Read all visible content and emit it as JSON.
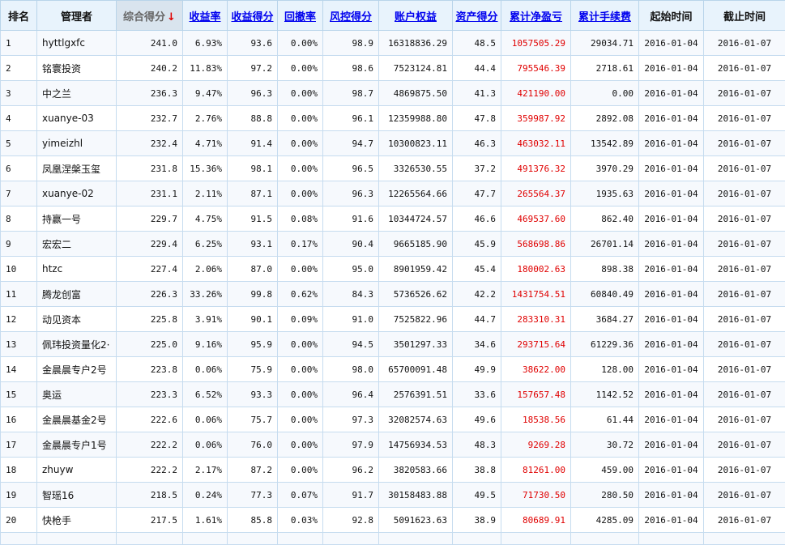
{
  "table": {
    "headers": {
      "rank": "排名",
      "manager": "管理者",
      "composite_score": "综合得分",
      "sort_arrow": "↓",
      "return_rate": "收益率",
      "return_score": "收益得分",
      "drawdown": "回撤率",
      "risk_score": "风控得分",
      "account_equity": "账户权益",
      "asset_score": "资产得分",
      "cum_net_profit": "累计净盈亏",
      "cum_fees": "累计手续费",
      "start_time": "起始时间",
      "end_time": "截止时间"
    },
    "accent_red": "#e00000",
    "link_blue": "#0000ee",
    "rows": [
      {
        "rank": "1",
        "manager": "hyttlgxfc",
        "composite": "241.0",
        "return_rate": "6.93%",
        "return_score": "93.6",
        "drawdown": "0.00%",
        "risk_score": "98.9",
        "equity": "16318836.29",
        "asset_score": "48.5",
        "net_profit": "1057505.29",
        "fees": "29034.71",
        "start": "2016-01-04",
        "end": "2016-01-07"
      },
      {
        "rank": "2",
        "manager": "铭寰投资",
        "composite": "240.2",
        "return_rate": "11.83%",
        "return_score": "97.2",
        "drawdown": "0.00%",
        "risk_score": "98.6",
        "equity": "7523124.81",
        "asset_score": "44.4",
        "net_profit": "795546.39",
        "fees": "2718.61",
        "start": "2016-01-04",
        "end": "2016-01-07"
      },
      {
        "rank": "3",
        "manager": "中之兰",
        "composite": "236.3",
        "return_rate": "9.47%",
        "return_score": "96.3",
        "drawdown": "0.00%",
        "risk_score": "98.7",
        "equity": "4869875.50",
        "asset_score": "41.3",
        "net_profit": "421190.00",
        "fees": "0.00",
        "start": "2016-01-04",
        "end": "2016-01-07"
      },
      {
        "rank": "4",
        "manager": "xuanye-03",
        "composite": "232.7",
        "return_rate": "2.76%",
        "return_score": "88.8",
        "drawdown": "0.00%",
        "risk_score": "96.1",
        "equity": "12359988.80",
        "asset_score": "47.8",
        "net_profit": "359987.92",
        "fees": "2892.08",
        "start": "2016-01-04",
        "end": "2016-01-07"
      },
      {
        "rank": "5",
        "manager": "yimeizhl",
        "composite": "232.4",
        "return_rate": "4.71%",
        "return_score": "91.4",
        "drawdown": "0.00%",
        "risk_score": "94.7",
        "equity": "10300823.11",
        "asset_score": "46.3",
        "net_profit": "463032.11",
        "fees": "13542.89",
        "start": "2016-01-04",
        "end": "2016-01-07"
      },
      {
        "rank": "6",
        "manager": "凤凰涅槃玉玺",
        "composite": "231.8",
        "return_rate": "15.36%",
        "return_score": "98.1",
        "drawdown": "0.00%",
        "risk_score": "96.5",
        "equity": "3326530.55",
        "asset_score": "37.2",
        "net_profit": "491376.32",
        "fees": "3970.29",
        "start": "2016-01-04",
        "end": "2016-01-07"
      },
      {
        "rank": "7",
        "manager": "xuanye-02",
        "composite": "231.1",
        "return_rate": "2.11%",
        "return_score": "87.1",
        "drawdown": "0.00%",
        "risk_score": "96.3",
        "equity": "12265564.66",
        "asset_score": "47.7",
        "net_profit": "265564.37",
        "fees": "1935.63",
        "start": "2016-01-04",
        "end": "2016-01-07"
      },
      {
        "rank": "8",
        "manager": "持赢一号",
        "composite": "229.7",
        "return_rate": "4.75%",
        "return_score": "91.5",
        "drawdown": "0.08%",
        "risk_score": "91.6",
        "equity": "10344724.57",
        "asset_score": "46.6",
        "net_profit": "469537.60",
        "fees": "862.40",
        "start": "2016-01-04",
        "end": "2016-01-07"
      },
      {
        "rank": "9",
        "manager": "宏宏二",
        "composite": "229.4",
        "return_rate": "6.25%",
        "return_score": "93.1",
        "drawdown": "0.17%",
        "risk_score": "90.4",
        "equity": "9665185.90",
        "asset_score": "45.9",
        "net_profit": "568698.86",
        "fees": "26701.14",
        "start": "2016-01-04",
        "end": "2016-01-07"
      },
      {
        "rank": "10",
        "manager": "htzc",
        "composite": "227.4",
        "return_rate": "2.06%",
        "return_score": "87.0",
        "drawdown": "0.00%",
        "risk_score": "95.0",
        "equity": "8901959.42",
        "asset_score": "45.4",
        "net_profit": "180002.63",
        "fees": "898.38",
        "start": "2016-01-04",
        "end": "2016-01-07"
      },
      {
        "rank": "11",
        "manager": "腾龙创富",
        "composite": "226.3",
        "return_rate": "33.26%",
        "return_score": "99.8",
        "drawdown": "0.62%",
        "risk_score": "84.3",
        "equity": "5736526.62",
        "asset_score": "42.2",
        "net_profit": "1431754.51",
        "fees": "60840.49",
        "start": "2016-01-04",
        "end": "2016-01-07"
      },
      {
        "rank": "12",
        "manager": "动见资本",
        "composite": "225.8",
        "return_rate": "3.91%",
        "return_score": "90.1",
        "drawdown": "0.09%",
        "risk_score": "91.0",
        "equity": "7525822.96",
        "asset_score": "44.7",
        "net_profit": "283310.31",
        "fees": "3684.27",
        "start": "2016-01-04",
        "end": "2016-01-07"
      },
      {
        "rank": "13",
        "manager": "佩玮投资量化2·",
        "composite": "225.0",
        "return_rate": "9.16%",
        "return_score": "95.9",
        "drawdown": "0.00%",
        "risk_score": "94.5",
        "equity": "3501297.33",
        "asset_score": "34.6",
        "net_profit": "293715.64",
        "fees": "61229.36",
        "start": "2016-01-04",
        "end": "2016-01-07"
      },
      {
        "rank": "14",
        "manager": "金晨晨专户2号",
        "composite": "223.8",
        "return_rate": "0.06%",
        "return_score": "75.9",
        "drawdown": "0.00%",
        "risk_score": "98.0",
        "equity": "65700091.48",
        "asset_score": "49.9",
        "net_profit": "38622.00",
        "fees": "128.00",
        "start": "2016-01-04",
        "end": "2016-01-07"
      },
      {
        "rank": "15",
        "manager": "奥运",
        "composite": "223.3",
        "return_rate": "6.52%",
        "return_score": "93.3",
        "drawdown": "0.00%",
        "risk_score": "96.4",
        "equity": "2576391.51",
        "asset_score": "33.6",
        "net_profit": "157657.48",
        "fees": "1142.52",
        "start": "2016-01-04",
        "end": "2016-01-07"
      },
      {
        "rank": "16",
        "manager": "金晨晨基金2号",
        "composite": "222.6",
        "return_rate": "0.06%",
        "return_score": "75.7",
        "drawdown": "0.00%",
        "risk_score": "97.3",
        "equity": "32082574.63",
        "asset_score": "49.6",
        "net_profit": "18538.56",
        "fees": "61.44",
        "start": "2016-01-04",
        "end": "2016-01-07"
      },
      {
        "rank": "17",
        "manager": "金晨晨专户1号",
        "composite": "222.2",
        "return_rate": "0.06%",
        "return_score": "76.0",
        "drawdown": "0.00%",
        "risk_score": "97.9",
        "equity": "14756934.53",
        "asset_score": "48.3",
        "net_profit": "9269.28",
        "fees": "30.72",
        "start": "2016-01-04",
        "end": "2016-01-07"
      },
      {
        "rank": "18",
        "manager": "zhuyw",
        "composite": "222.2",
        "return_rate": "2.17%",
        "return_score": "87.2",
        "drawdown": "0.00%",
        "risk_score": "96.2",
        "equity": "3820583.66",
        "asset_score": "38.8",
        "net_profit": "81261.00",
        "fees": "459.00",
        "start": "2016-01-04",
        "end": "2016-01-07"
      },
      {
        "rank": "19",
        "manager": "智瑶16",
        "composite": "218.5",
        "return_rate": "0.24%",
        "return_score": "77.3",
        "drawdown": "0.07%",
        "risk_score": "91.7",
        "equity": "30158483.88",
        "asset_score": "49.5",
        "net_profit": "71730.50",
        "fees": "280.50",
        "start": "2016-01-04",
        "end": "2016-01-07"
      },
      {
        "rank": "20",
        "manager": "快枪手",
        "composite": "217.5",
        "return_rate": "1.61%",
        "return_score": "85.8",
        "drawdown": "0.03%",
        "risk_score": "92.8",
        "equity": "5091623.63",
        "asset_score": "38.9",
        "net_profit": "80689.91",
        "fees": "4285.09",
        "start": "2016-01-04",
        "end": "2016-01-07"
      }
    ]
  }
}
